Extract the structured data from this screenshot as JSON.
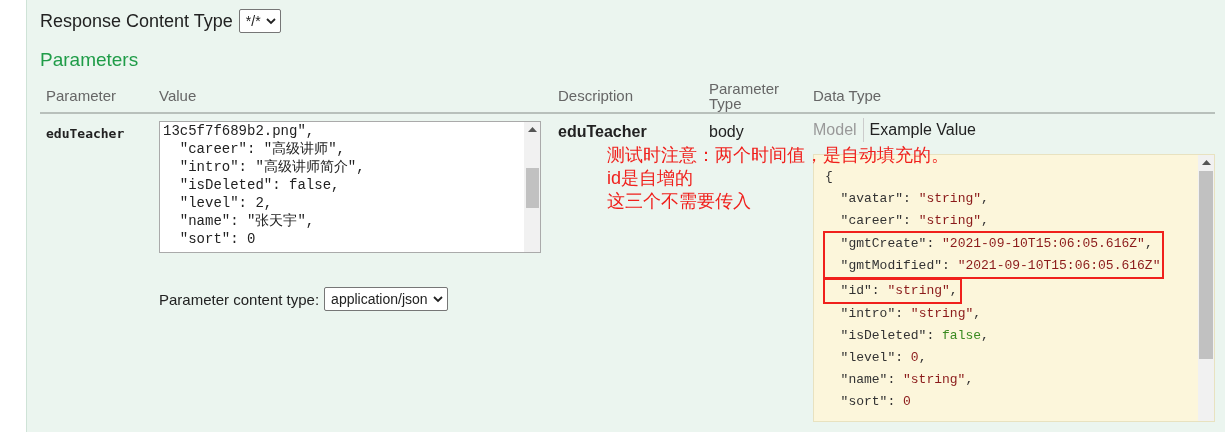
{
  "response_content_type": {
    "label": "Response Content Type",
    "value": "*/*"
  },
  "parameters": {
    "title": "Parameters",
    "columns": [
      "Parameter",
      "Value",
      "Description",
      "Parameter Type",
      "Data Type"
    ],
    "rows": [
      {
        "name": "eduTeacher",
        "value_lines": [
          "13c5f7f689b2.png\",",
          "  \"career\": \"高级讲师\",",
          "  \"intro\": \"高级讲师简介\",",
          "  \"isDeleted\": false,",
          "  \"level\": 2,",
          "  \"name\": \"张天宇\",",
          "  \"sort\": 0"
        ],
        "content_type": {
          "label": "Parameter content type:",
          "value": "application/json"
        },
        "description": "eduTeacher",
        "parameter_type": "body",
        "data_type": {
          "tabs": [
            {
              "label": "Model",
              "selected": false
            },
            {
              "label": "Example Value",
              "selected": true
            }
          ],
          "example_blocks": [
            {
              "boxed": false,
              "lines": [
                [
                  {
                    "kind": "punct",
                    "text": "{"
                  }
                ],
                [
                  {
                    "kind": "key",
                    "text": "  \"avatar\": "
                  },
                  {
                    "kind": "string",
                    "text": "\"string\""
                  },
                  {
                    "kind": "punct",
                    "text": ","
                  }
                ],
                [
                  {
                    "kind": "key",
                    "text": "  \"career\": "
                  },
                  {
                    "kind": "string",
                    "text": "\"string\""
                  },
                  {
                    "kind": "punct",
                    "text": ","
                  }
                ]
              ]
            },
            {
              "boxed": true,
              "lines": [
                [
                  {
                    "kind": "key",
                    "text": "  \"gmtCreate\": "
                  },
                  {
                    "kind": "string",
                    "text": "\"2021-09-10T15:06:05.616Z\""
                  },
                  {
                    "kind": "punct",
                    "text": ","
                  }
                ],
                [
                  {
                    "kind": "key",
                    "text": "  \"gmtModified\": "
                  },
                  {
                    "kind": "string",
                    "text": "\"2021-09-10T15:06:05.616Z\""
                  }
                ]
              ]
            },
            {
              "boxed": true,
              "lines": [
                [
                  {
                    "kind": "key",
                    "text": "  \"id\": "
                  },
                  {
                    "kind": "string",
                    "text": "\"string\""
                  },
                  {
                    "kind": "punct",
                    "text": ","
                  }
                ]
              ]
            },
            {
              "boxed": false,
              "lines": [
                [
                  {
                    "kind": "key",
                    "text": "  \"intro\": "
                  },
                  {
                    "kind": "string",
                    "text": "\"string\""
                  },
                  {
                    "kind": "punct",
                    "text": ","
                  }
                ],
                [
                  {
                    "kind": "key",
                    "text": "  \"isDeleted\": "
                  },
                  {
                    "kind": "boolean",
                    "text": "false"
                  },
                  {
                    "kind": "punct",
                    "text": ","
                  }
                ],
                [
                  {
                    "kind": "key",
                    "text": "  \"level\": "
                  },
                  {
                    "kind": "number",
                    "text": "0"
                  },
                  {
                    "kind": "punct",
                    "text": ","
                  }
                ],
                [
                  {
                    "kind": "key",
                    "text": "  \"name\": "
                  },
                  {
                    "kind": "string",
                    "text": "\"string\""
                  },
                  {
                    "kind": "punct",
                    "text": ","
                  }
                ],
                [
                  {
                    "kind": "key",
                    "text": "  \"sort\": "
                  },
                  {
                    "kind": "number",
                    "text": "0"
                  }
                ]
              ]
            }
          ]
        }
      }
    ]
  },
  "annotation": [
    "测试时注意：两个时间值，是自动填充的。",
    "id是自增的",
    "这三个不需要传入"
  ]
}
